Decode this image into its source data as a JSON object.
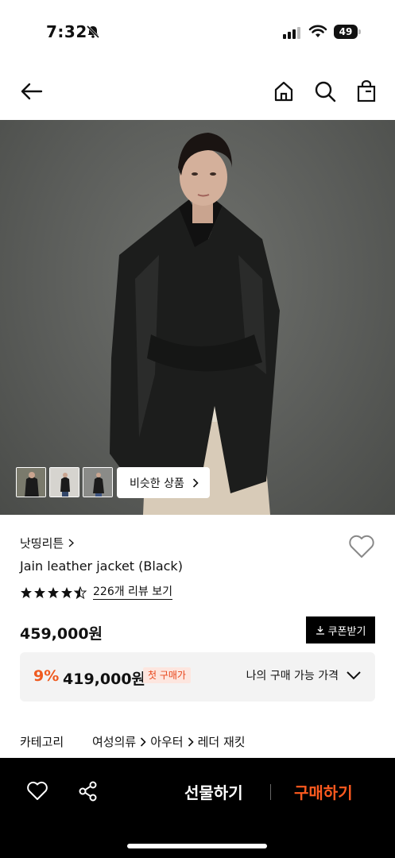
{
  "status": {
    "time": "7:32",
    "battery": "49"
  },
  "nav": {
    "back_icon": "arrow-left-icon",
    "home_icon": "home-icon",
    "search_icon": "search-icon",
    "bag_icon": "shopping-bag-icon"
  },
  "gallery": {
    "similar_label": "비슷한 상품"
  },
  "product": {
    "brand": "낫띵리튼",
    "name": "Jain leather jacket (Black)",
    "rating": 4.5,
    "review_label": "226개 리뷰 보기",
    "price": "459,000원",
    "coupon_label": "쿠폰받기"
  },
  "discount": {
    "rate": "9%",
    "price": "419,000원",
    "badge": "첫 구매가",
    "my_price_label": "나의 구매 가능 가격"
  },
  "category": {
    "label": "카테고리",
    "path": [
      "여성의류",
      "아우터",
      "레더 재킷"
    ]
  },
  "bottom": {
    "gift_label": "선물하기",
    "buy_label": "구매하기",
    "accent": "#ff5a1f"
  }
}
